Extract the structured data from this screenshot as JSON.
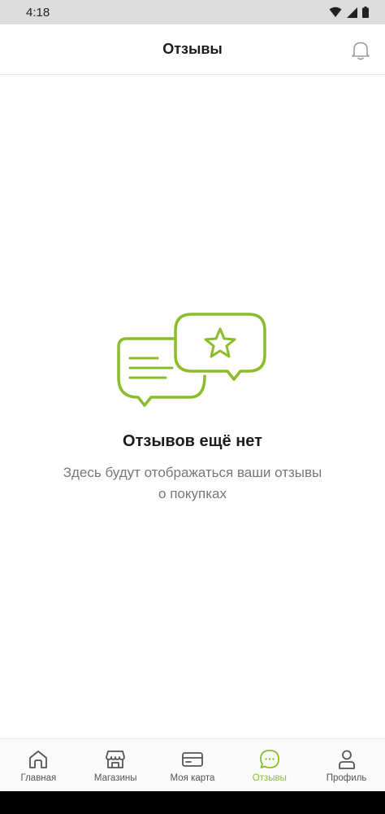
{
  "status_bar": {
    "time": "4:18"
  },
  "header": {
    "title": "Отзывы"
  },
  "empty_state": {
    "title": "Отзывов ещё нет",
    "subtitle": "Здесь будут отображаться ваши отзывы о покупках"
  },
  "tabs": [
    {
      "label": "Главная",
      "icon": "home-icon",
      "active": false
    },
    {
      "label": "Магазины",
      "icon": "store-icon",
      "active": false
    },
    {
      "label": "Моя карта",
      "icon": "card-icon",
      "active": false
    },
    {
      "label": "Отзывы",
      "icon": "chat-icon",
      "active": true
    },
    {
      "label": "Профиль",
      "icon": "profile-icon",
      "active": false
    }
  ],
  "colors": {
    "accent": "#8bbd2a",
    "status_bar": "#dcdcdc",
    "inactive_icon": "#555555"
  }
}
